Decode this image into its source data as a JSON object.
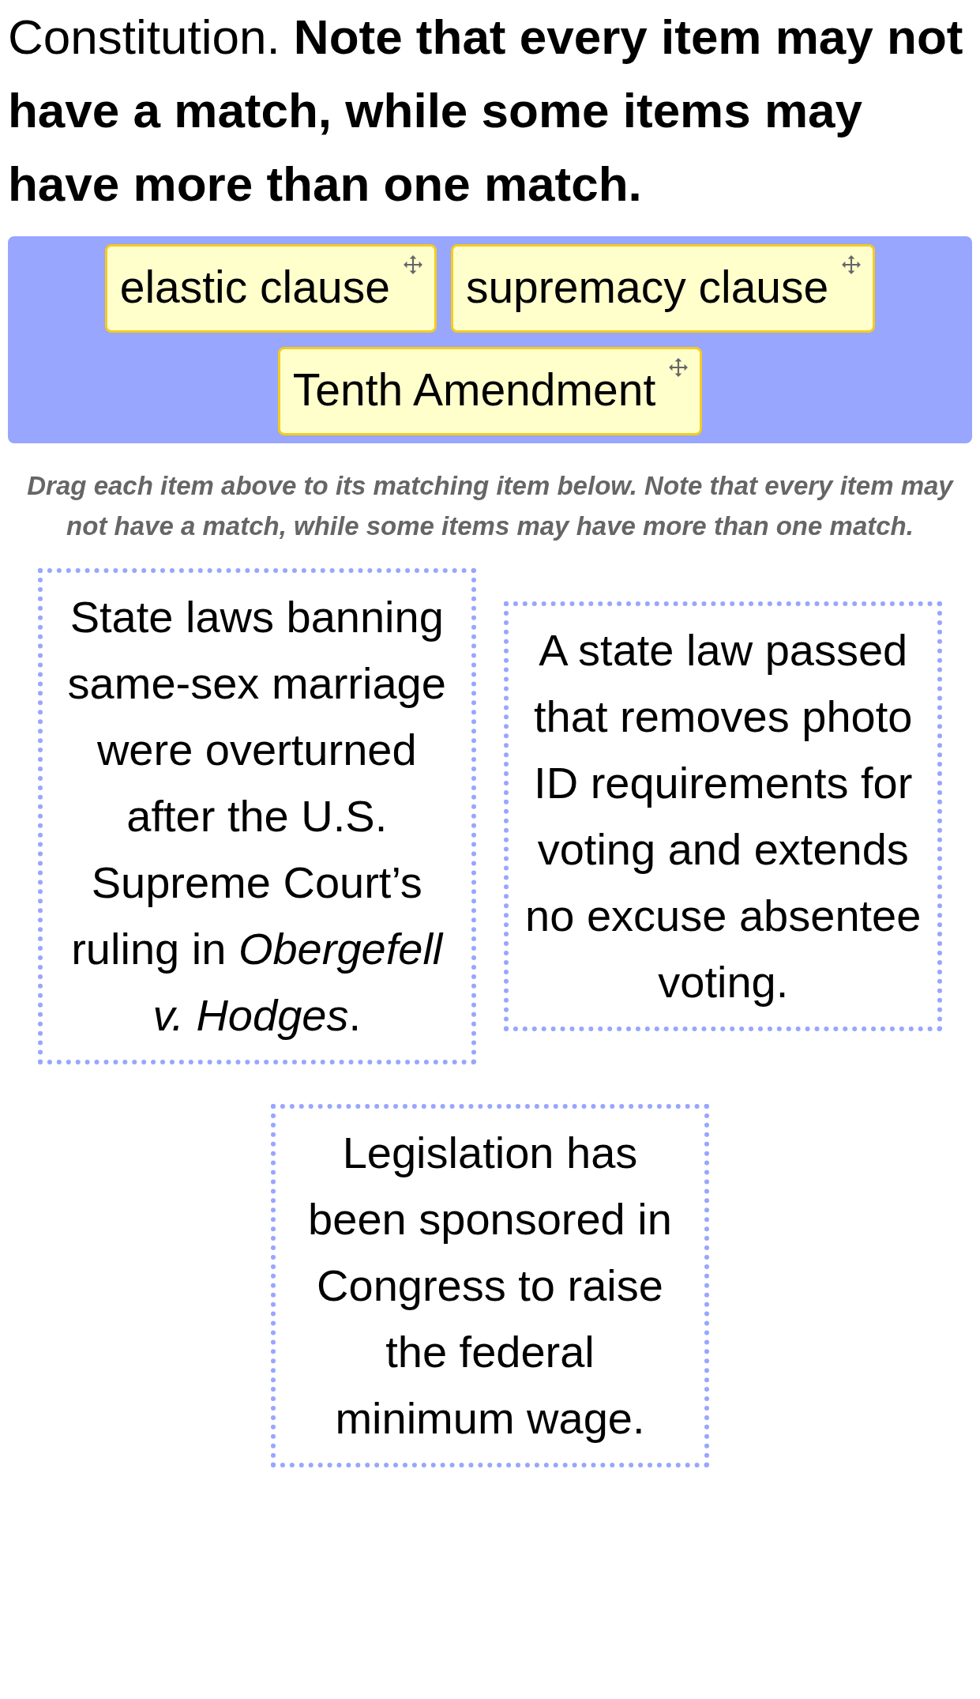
{
  "question": {
    "text": "Constitution. **Note that every item may not have a match, while some items may have more than one match.**"
  },
  "drag_items": [
    {
      "label": "elastic clause"
    },
    {
      "label": "supremacy clause"
    },
    {
      "label": "Tenth Amendment"
    }
  ],
  "instructions": "Drag each item above to its matching item below. Note that every item may not have a match, while some items may have more than one match.",
  "drop_targets": [
    {
      "text": "State laws banning same-sex marriage were overturned after the U.S. Supreme Court’s ruling in *Obergefell v. Hodges*."
    },
    {
      "text": "A state law passed that removes photo ID requirements for voting and extends no excuse absentee voting."
    },
    {
      "text": "Legislation has been sponsored in Congress to raise the federal minimum wage."
    }
  ]
}
